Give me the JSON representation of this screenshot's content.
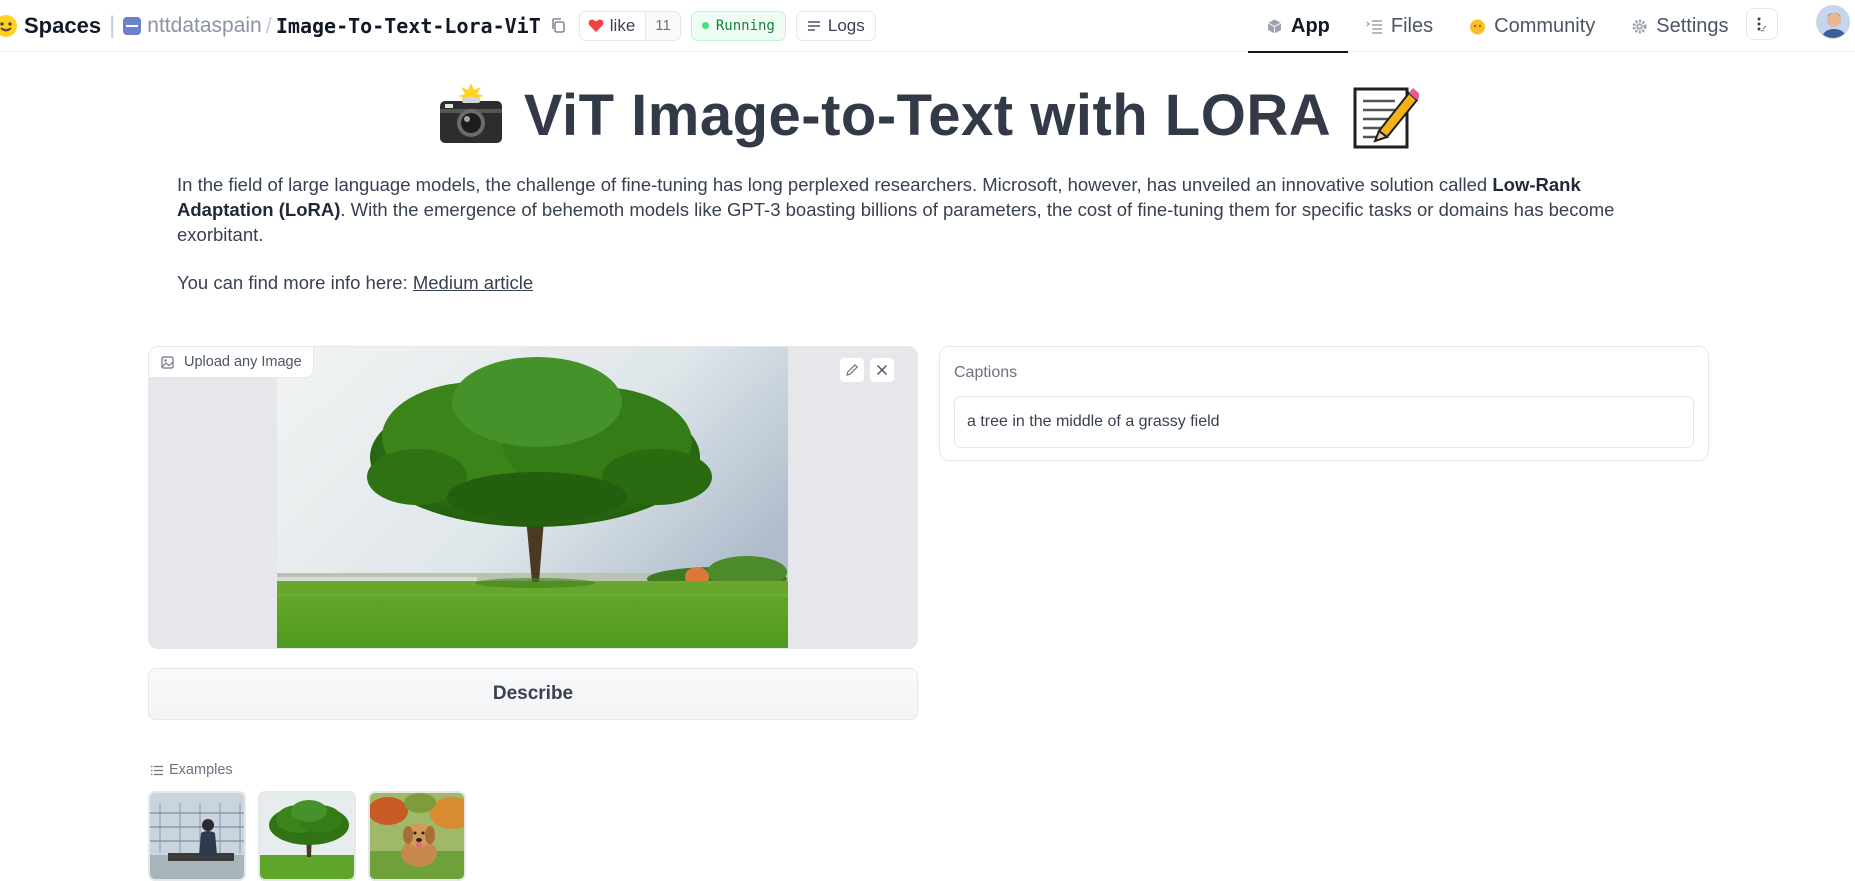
{
  "header": {
    "brand": "Spaces",
    "org": "nttdataspain",
    "repo": "Image-To-Text-Lora-ViT",
    "like_label": "like",
    "like_count": "11",
    "status": "Running",
    "logs_label": "Logs",
    "tabs": [
      {
        "label": "App",
        "icon": "cube-icon",
        "active": true
      },
      {
        "label": "Files",
        "icon": "files-icon",
        "active": false
      },
      {
        "label": "Community",
        "icon": "community-icon",
        "active": false
      },
      {
        "label": "Settings",
        "icon": "gear-icon",
        "active": false
      }
    ]
  },
  "main": {
    "title": "ViT Image-to-Text with LORA",
    "intro": {
      "before_bold": "In the field of large language models, the challenge of fine-tuning has long perplexed researchers. Microsoft, however, has unveiled an innovative solution called ",
      "bold": "Low-Rank Adaptation (LoRA)",
      "after_bold": ". With the emergence of behemoth models like GPT-3 boasting billions of parameters, the cost of fine-tuning them for specific tasks or domains has become exorbitant."
    },
    "more_info": {
      "prefix": "You can find more info here: ",
      "link_text": "Medium article"
    },
    "image_input": {
      "label": "Upload any Image"
    },
    "describe_button": "Describe",
    "captions": {
      "label": "Captions",
      "value": "a tree in the middle of a grassy field"
    },
    "examples": {
      "label": "Examples",
      "count": 3
    }
  },
  "colors": {
    "status_green": "#15803d",
    "heart_red": "#ef4444",
    "title_text": "#323a48"
  }
}
